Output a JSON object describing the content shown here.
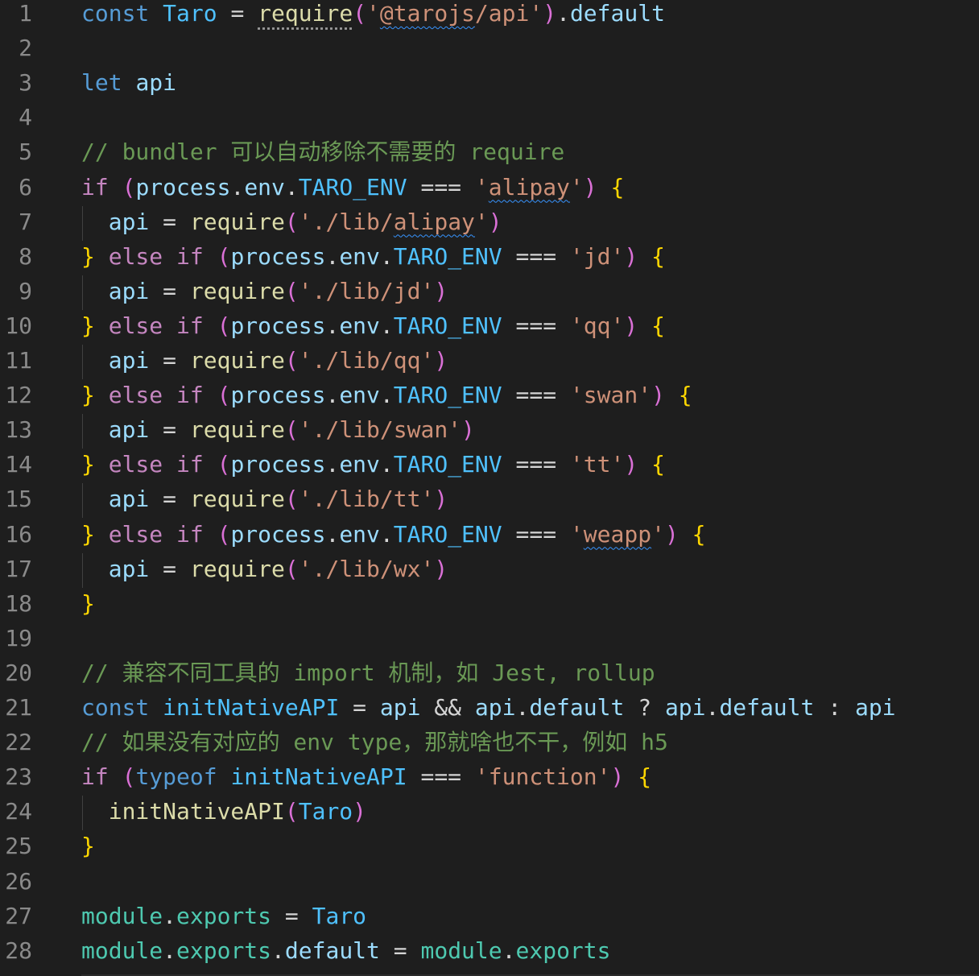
{
  "editor": {
    "theme_colors": {
      "background": "#1e1e1e",
      "keyword": "#569cd6",
      "control": "#c586c0",
      "variable": "#9cdcfe",
      "constant": "#4fc1ff",
      "function": "#dcdcaa",
      "string": "#ce9178",
      "comment": "#6a9955",
      "module": "#4ec9b0",
      "bracket_level1": "#ffd700",
      "bracket_level2": "#da70d6",
      "bracket_level3": "#179fff"
    },
    "lines": [
      {
        "n": "1",
        "tokens": [
          [
            "kw",
            "const"
          ],
          [
            "op",
            " "
          ],
          [
            "const",
            "Taro"
          ],
          [
            "op",
            " = "
          ],
          [
            "fn",
            "require",
            "dotted"
          ],
          [
            "br2",
            "("
          ],
          [
            "str",
            "'"
          ],
          [
            "str",
            "@tarojs",
            "squiggle"
          ],
          [
            "str",
            "/api'"
          ],
          [
            "br2",
            ")"
          ],
          [
            "op",
            "."
          ],
          [
            "var",
            "default"
          ]
        ]
      },
      {
        "n": "2",
        "tokens": []
      },
      {
        "n": "3",
        "tokens": [
          [
            "kw",
            "let"
          ],
          [
            "op",
            " "
          ],
          [
            "var",
            "api"
          ]
        ]
      },
      {
        "n": "4",
        "tokens": []
      },
      {
        "n": "5",
        "tokens": [
          [
            "cmt",
            "// bundler 可以自动移除不需要的 require"
          ]
        ]
      },
      {
        "n": "6",
        "tokens": [
          [
            "ctrl",
            "if"
          ],
          [
            "op",
            " "
          ],
          [
            "br2",
            "("
          ],
          [
            "var",
            "process"
          ],
          [
            "op",
            "."
          ],
          [
            "var",
            "env"
          ],
          [
            "op",
            "."
          ],
          [
            "const",
            "TARO_ENV"
          ],
          [
            "op",
            " === "
          ],
          [
            "str",
            "'"
          ],
          [
            "str",
            "alipay",
            "squiggle"
          ],
          [
            "str",
            "'"
          ],
          [
            "br2",
            ")"
          ],
          [
            "op",
            " "
          ],
          [
            "br1",
            "{"
          ]
        ]
      },
      {
        "n": "7",
        "guide": true,
        "tokens": [
          [
            "op",
            "  "
          ],
          [
            "var",
            "api"
          ],
          [
            "op",
            " = "
          ],
          [
            "fn",
            "require"
          ],
          [
            "br2",
            "("
          ],
          [
            "str",
            "'./lib/"
          ],
          [
            "str",
            "alipay",
            "squiggle"
          ],
          [
            "str",
            "'"
          ],
          [
            "br2",
            ")"
          ]
        ]
      },
      {
        "n": "8",
        "tokens": [
          [
            "br1",
            "}"
          ],
          [
            "op",
            " "
          ],
          [
            "ctrl",
            "else"
          ],
          [
            "op",
            " "
          ],
          [
            "ctrl",
            "if"
          ],
          [
            "op",
            " "
          ],
          [
            "br2",
            "("
          ],
          [
            "var",
            "process"
          ],
          [
            "op",
            "."
          ],
          [
            "var",
            "env"
          ],
          [
            "op",
            "."
          ],
          [
            "const",
            "TARO_ENV"
          ],
          [
            "op",
            " === "
          ],
          [
            "str",
            "'jd'"
          ],
          [
            "br2",
            ")"
          ],
          [
            "op",
            " "
          ],
          [
            "br1",
            "{"
          ]
        ]
      },
      {
        "n": "9",
        "guide": true,
        "tokens": [
          [
            "op",
            "  "
          ],
          [
            "var",
            "api"
          ],
          [
            "op",
            " = "
          ],
          [
            "fn",
            "require"
          ],
          [
            "br2",
            "("
          ],
          [
            "str",
            "'./lib/jd'"
          ],
          [
            "br2",
            ")"
          ]
        ]
      },
      {
        "n": "10",
        "tokens": [
          [
            "br1",
            "}"
          ],
          [
            "op",
            " "
          ],
          [
            "ctrl",
            "else"
          ],
          [
            "op",
            " "
          ],
          [
            "ctrl",
            "if"
          ],
          [
            "op",
            " "
          ],
          [
            "br2",
            "("
          ],
          [
            "var",
            "process"
          ],
          [
            "op",
            "."
          ],
          [
            "var",
            "env"
          ],
          [
            "op",
            "."
          ],
          [
            "const",
            "TARO_ENV"
          ],
          [
            "op",
            " === "
          ],
          [
            "str",
            "'qq'"
          ],
          [
            "br2",
            ")"
          ],
          [
            "op",
            " "
          ],
          [
            "br1",
            "{"
          ]
        ]
      },
      {
        "n": "11",
        "guide": true,
        "tokens": [
          [
            "op",
            "  "
          ],
          [
            "var",
            "api"
          ],
          [
            "op",
            " = "
          ],
          [
            "fn",
            "require"
          ],
          [
            "br2",
            "("
          ],
          [
            "str",
            "'./lib/qq'"
          ],
          [
            "br2",
            ")"
          ]
        ]
      },
      {
        "n": "12",
        "tokens": [
          [
            "br1",
            "}"
          ],
          [
            "op",
            " "
          ],
          [
            "ctrl",
            "else"
          ],
          [
            "op",
            " "
          ],
          [
            "ctrl",
            "if"
          ],
          [
            "op",
            " "
          ],
          [
            "br2",
            "("
          ],
          [
            "var",
            "process"
          ],
          [
            "op",
            "."
          ],
          [
            "var",
            "env"
          ],
          [
            "op",
            "."
          ],
          [
            "const",
            "TARO_ENV"
          ],
          [
            "op",
            " === "
          ],
          [
            "str",
            "'swan'"
          ],
          [
            "br2",
            ")"
          ],
          [
            "op",
            " "
          ],
          [
            "br1",
            "{"
          ]
        ]
      },
      {
        "n": "13",
        "guide": true,
        "tokens": [
          [
            "op",
            "  "
          ],
          [
            "var",
            "api"
          ],
          [
            "op",
            " = "
          ],
          [
            "fn",
            "require"
          ],
          [
            "br2",
            "("
          ],
          [
            "str",
            "'./lib/swan'"
          ],
          [
            "br2",
            ")"
          ]
        ]
      },
      {
        "n": "14",
        "tokens": [
          [
            "br1",
            "}"
          ],
          [
            "op",
            " "
          ],
          [
            "ctrl",
            "else"
          ],
          [
            "op",
            " "
          ],
          [
            "ctrl",
            "if"
          ],
          [
            "op",
            " "
          ],
          [
            "br2",
            "("
          ],
          [
            "var",
            "process"
          ],
          [
            "op",
            "."
          ],
          [
            "var",
            "env"
          ],
          [
            "op",
            "."
          ],
          [
            "const",
            "TARO_ENV"
          ],
          [
            "op",
            " === "
          ],
          [
            "str",
            "'tt'"
          ],
          [
            "br2",
            ")"
          ],
          [
            "op",
            " "
          ],
          [
            "br1",
            "{"
          ]
        ]
      },
      {
        "n": "15",
        "guide": true,
        "tokens": [
          [
            "op",
            "  "
          ],
          [
            "var",
            "api"
          ],
          [
            "op",
            " = "
          ],
          [
            "fn",
            "require"
          ],
          [
            "br2",
            "("
          ],
          [
            "str",
            "'./lib/tt'"
          ],
          [
            "br2",
            ")"
          ]
        ]
      },
      {
        "n": "16",
        "tokens": [
          [
            "br1",
            "}"
          ],
          [
            "op",
            " "
          ],
          [
            "ctrl",
            "else"
          ],
          [
            "op",
            " "
          ],
          [
            "ctrl",
            "if"
          ],
          [
            "op",
            " "
          ],
          [
            "br2",
            "("
          ],
          [
            "var",
            "process"
          ],
          [
            "op",
            "."
          ],
          [
            "var",
            "env"
          ],
          [
            "op",
            "."
          ],
          [
            "const",
            "TARO_ENV"
          ],
          [
            "op",
            " === "
          ],
          [
            "str",
            "'"
          ],
          [
            "str",
            "weapp",
            "squiggle"
          ],
          [
            "str",
            "'"
          ],
          [
            "br2",
            ")"
          ],
          [
            "op",
            " "
          ],
          [
            "br1",
            "{"
          ]
        ]
      },
      {
        "n": "17",
        "guide": true,
        "tokens": [
          [
            "op",
            "  "
          ],
          [
            "var",
            "api"
          ],
          [
            "op",
            " = "
          ],
          [
            "fn",
            "require"
          ],
          [
            "br2",
            "("
          ],
          [
            "str",
            "'./lib/wx'"
          ],
          [
            "br2",
            ")"
          ]
        ]
      },
      {
        "n": "18",
        "tokens": [
          [
            "br1",
            "}"
          ]
        ]
      },
      {
        "n": "19",
        "tokens": []
      },
      {
        "n": "20",
        "tokens": [
          [
            "cmt",
            "// 兼容不同工具的 import 机制，如 Jest, rollup"
          ]
        ]
      },
      {
        "n": "21",
        "tokens": [
          [
            "kw",
            "const"
          ],
          [
            "op",
            " "
          ],
          [
            "const",
            "initNativeAPI"
          ],
          [
            "op",
            " = "
          ],
          [
            "var",
            "api"
          ],
          [
            "op",
            " && "
          ],
          [
            "var",
            "api"
          ],
          [
            "op",
            "."
          ],
          [
            "var",
            "default"
          ],
          [
            "op",
            " ? "
          ],
          [
            "var",
            "api"
          ],
          [
            "op",
            "."
          ],
          [
            "var",
            "default"
          ],
          [
            "op",
            " : "
          ],
          [
            "var",
            "api"
          ]
        ]
      },
      {
        "n": "22",
        "tokens": [
          [
            "cmt",
            "// 如果没有对应的 env type，那就啥也不干，例如 h5"
          ]
        ]
      },
      {
        "n": "23",
        "tokens": [
          [
            "ctrl",
            "if"
          ],
          [
            "op",
            " "
          ],
          [
            "br2",
            "("
          ],
          [
            "kw",
            "typeof"
          ],
          [
            "op",
            " "
          ],
          [
            "const",
            "initNativeAPI"
          ],
          [
            "op",
            " === "
          ],
          [
            "str",
            "'function'"
          ],
          [
            "br2",
            ")"
          ],
          [
            "op",
            " "
          ],
          [
            "br1",
            "{"
          ]
        ]
      },
      {
        "n": "24",
        "guide": true,
        "tokens": [
          [
            "op",
            "  "
          ],
          [
            "fn",
            "initNativeAPI"
          ],
          [
            "br2",
            "("
          ],
          [
            "const",
            "Taro"
          ],
          [
            "br2",
            ")"
          ]
        ]
      },
      {
        "n": "25",
        "tokens": [
          [
            "br1",
            "}"
          ]
        ]
      },
      {
        "n": "26",
        "tokens": []
      },
      {
        "n": "27",
        "tokens": [
          [
            "cls",
            "module"
          ],
          [
            "op",
            "."
          ],
          [
            "cls",
            "exports"
          ],
          [
            "op",
            " = "
          ],
          [
            "const",
            "Taro"
          ]
        ]
      },
      {
        "n": "28",
        "tokens": [
          [
            "cls",
            "module"
          ],
          [
            "op",
            "."
          ],
          [
            "cls",
            "exports"
          ],
          [
            "op",
            "."
          ],
          [
            "var",
            "default"
          ],
          [
            "op",
            " = "
          ],
          [
            "cls",
            "module"
          ],
          [
            "op",
            "."
          ],
          [
            "cls",
            "exports"
          ]
        ]
      }
    ]
  }
}
